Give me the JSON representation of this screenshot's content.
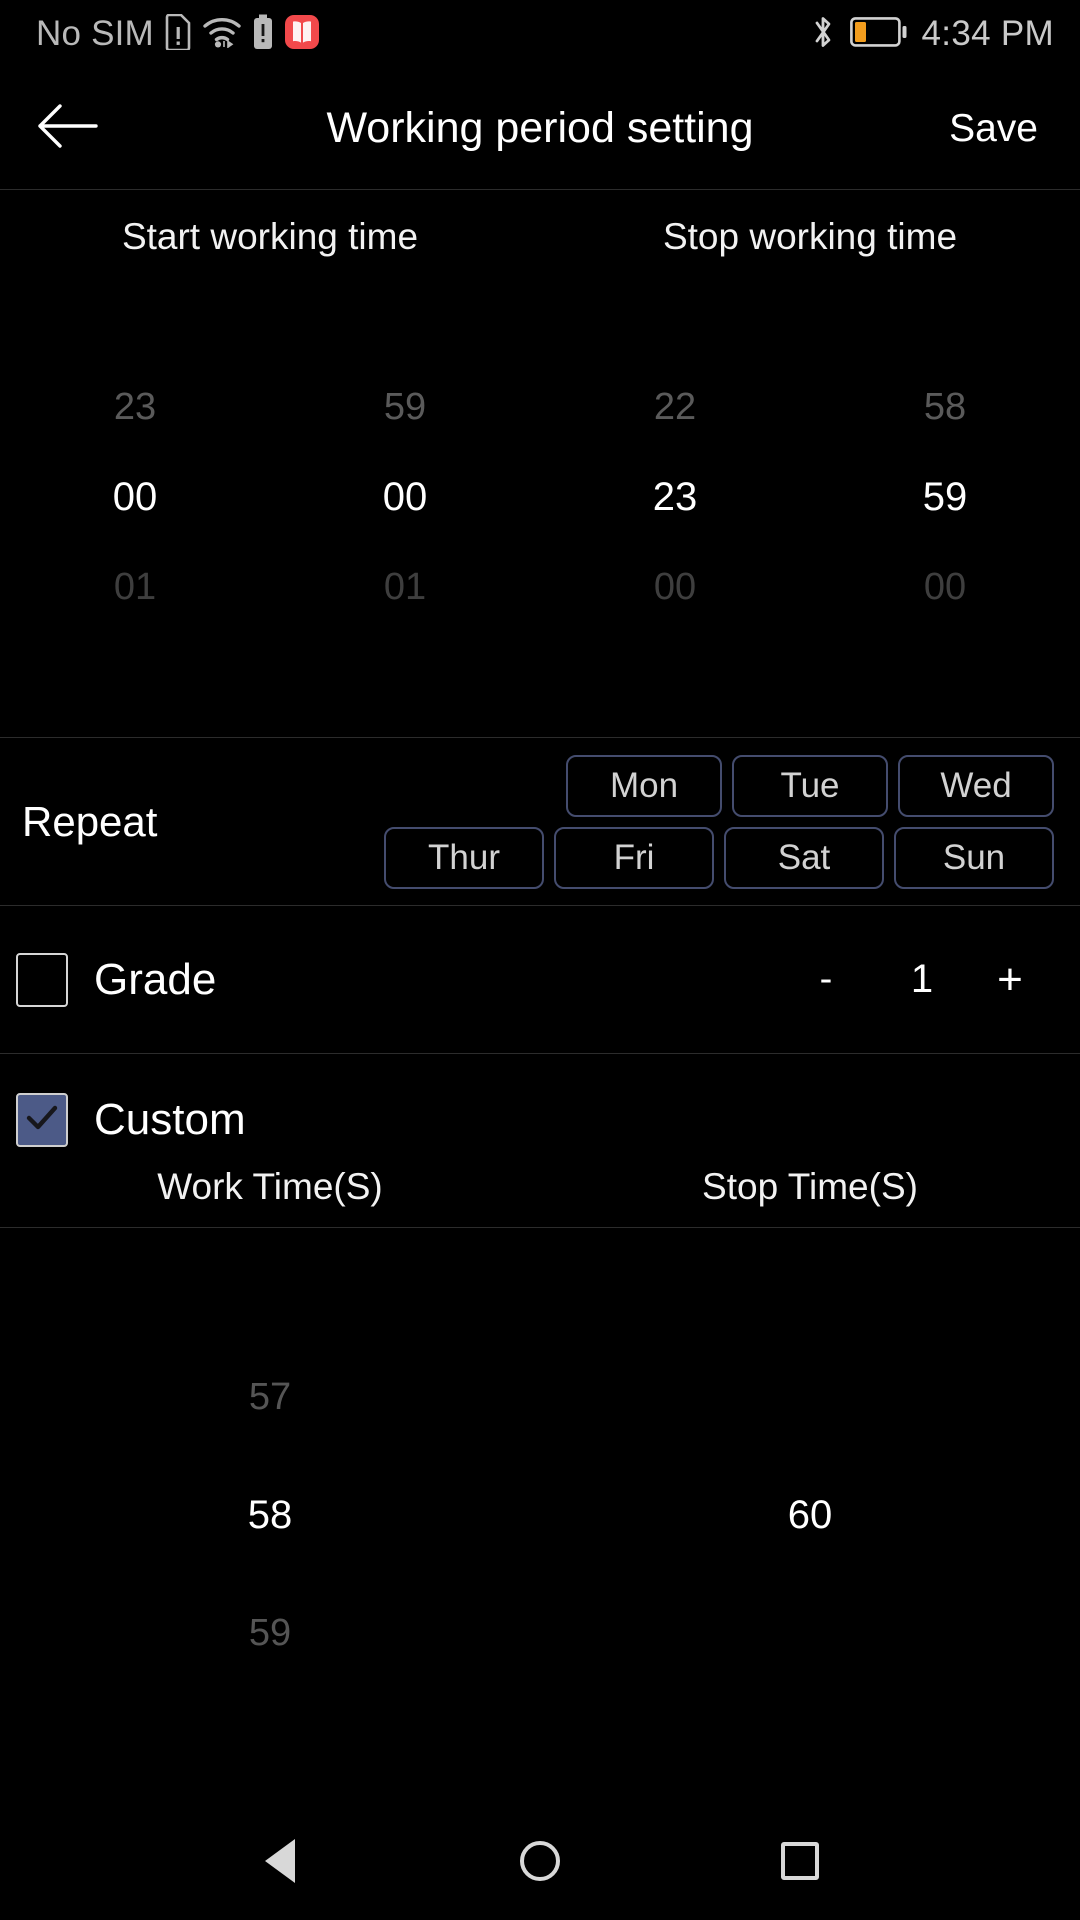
{
  "status_bar": {
    "carrier": "No SIM",
    "time": "4:34 PM",
    "icons": [
      "sim-alert-icon",
      "wifi-icon",
      "battery-alert-icon",
      "book-app-icon",
      "bluetooth-icon",
      "battery-icon"
    ],
    "battery_level_percent": 25,
    "battery_fill_color": "#f29d1e"
  },
  "header": {
    "back_icon": "arrow-left-icon",
    "title": "Working period setting",
    "save_label": "Save"
  },
  "time_picker": {
    "columns": [
      {
        "label": "Start working time",
        "head_span": 2
      },
      {
        "label": "Stop working time",
        "head_span": 2
      }
    ],
    "heads": [
      "Start working time",
      "Stop working time"
    ],
    "wheels": [
      {
        "name": "start-hour",
        "above": "23",
        "selected": "00",
        "below": "01"
      },
      {
        "name": "start-minute",
        "above": "59",
        "selected": "00",
        "below": "01"
      },
      {
        "name": "stop-hour",
        "above": "22",
        "selected": "23",
        "below": "00"
      },
      {
        "name": "stop-minute",
        "above": "58",
        "selected": "59",
        "below": "00"
      }
    ]
  },
  "repeat": {
    "label": "Repeat",
    "border_color": "#444c6e",
    "row1": [
      "Mon",
      "Tue",
      "Wed"
    ],
    "row2": [
      "Thur",
      "Fri",
      "Sat",
      "Sun"
    ]
  },
  "grade": {
    "label": "Grade",
    "checked": false,
    "minus_label": "-",
    "value": "1",
    "plus_label": "+"
  },
  "custom": {
    "label": "Custom",
    "checked": true,
    "checkbox_color": "#4c5a87",
    "heads": [
      "Work Time(S)",
      "Stop Time(S)"
    ],
    "work_wheel": {
      "above": "57",
      "selected": "58",
      "below": "59"
    },
    "stop_wheel": {
      "above": "",
      "selected": "60",
      "below": ""
    }
  },
  "nav_bar": {
    "back": "triangle-back-icon",
    "home": "circle-home-icon",
    "recents": "square-recents-icon"
  }
}
